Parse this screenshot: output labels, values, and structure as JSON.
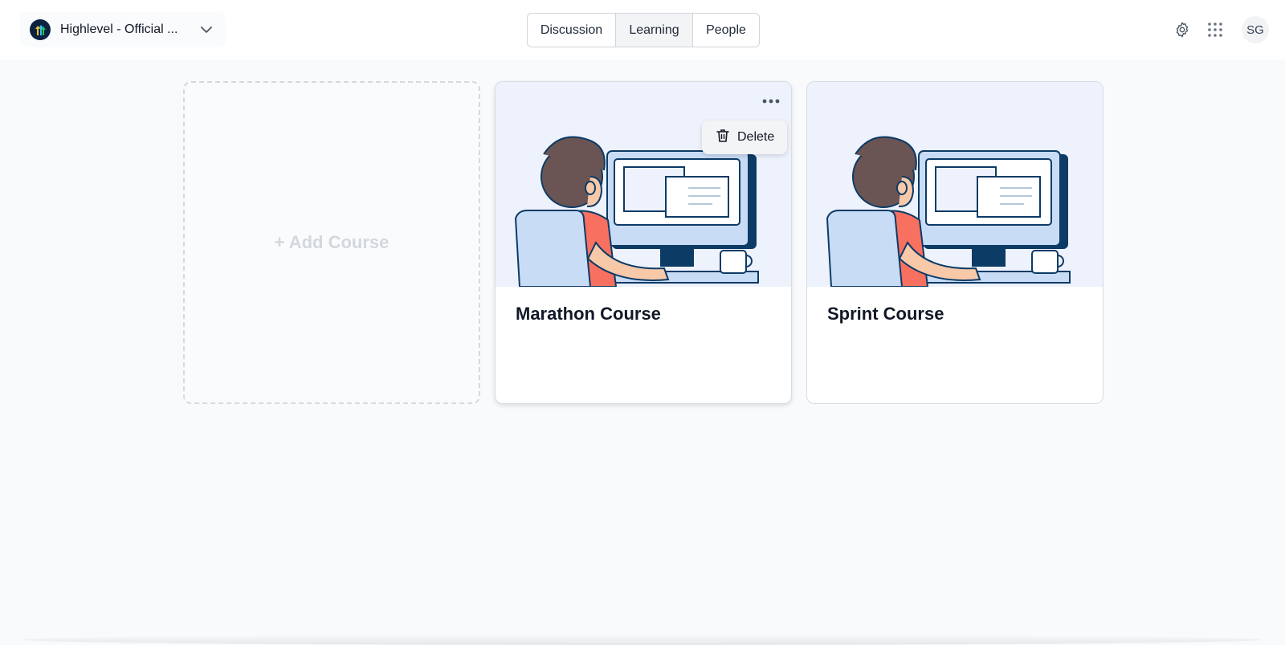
{
  "header": {
    "org_name": "Highlevel - Official ...",
    "tabs": [
      "Discussion",
      "Learning",
      "People"
    ],
    "active_tab": "Learning",
    "avatar_initials": "SG",
    "icons": [
      "chevron-down-icon",
      "settings-gear-icon",
      "apps-grid-icon"
    ]
  },
  "main": {
    "add_course_label": "+ Add Course",
    "courses": [
      {
        "title": "Marathon Course"
      },
      {
        "title": "Sprint Course"
      }
    ]
  },
  "menu": {
    "delete_label": "Delete"
  },
  "colors": {
    "accent_red": "#f87060",
    "navy": "#0c3b66",
    "card_bg": "#eef2fc"
  }
}
